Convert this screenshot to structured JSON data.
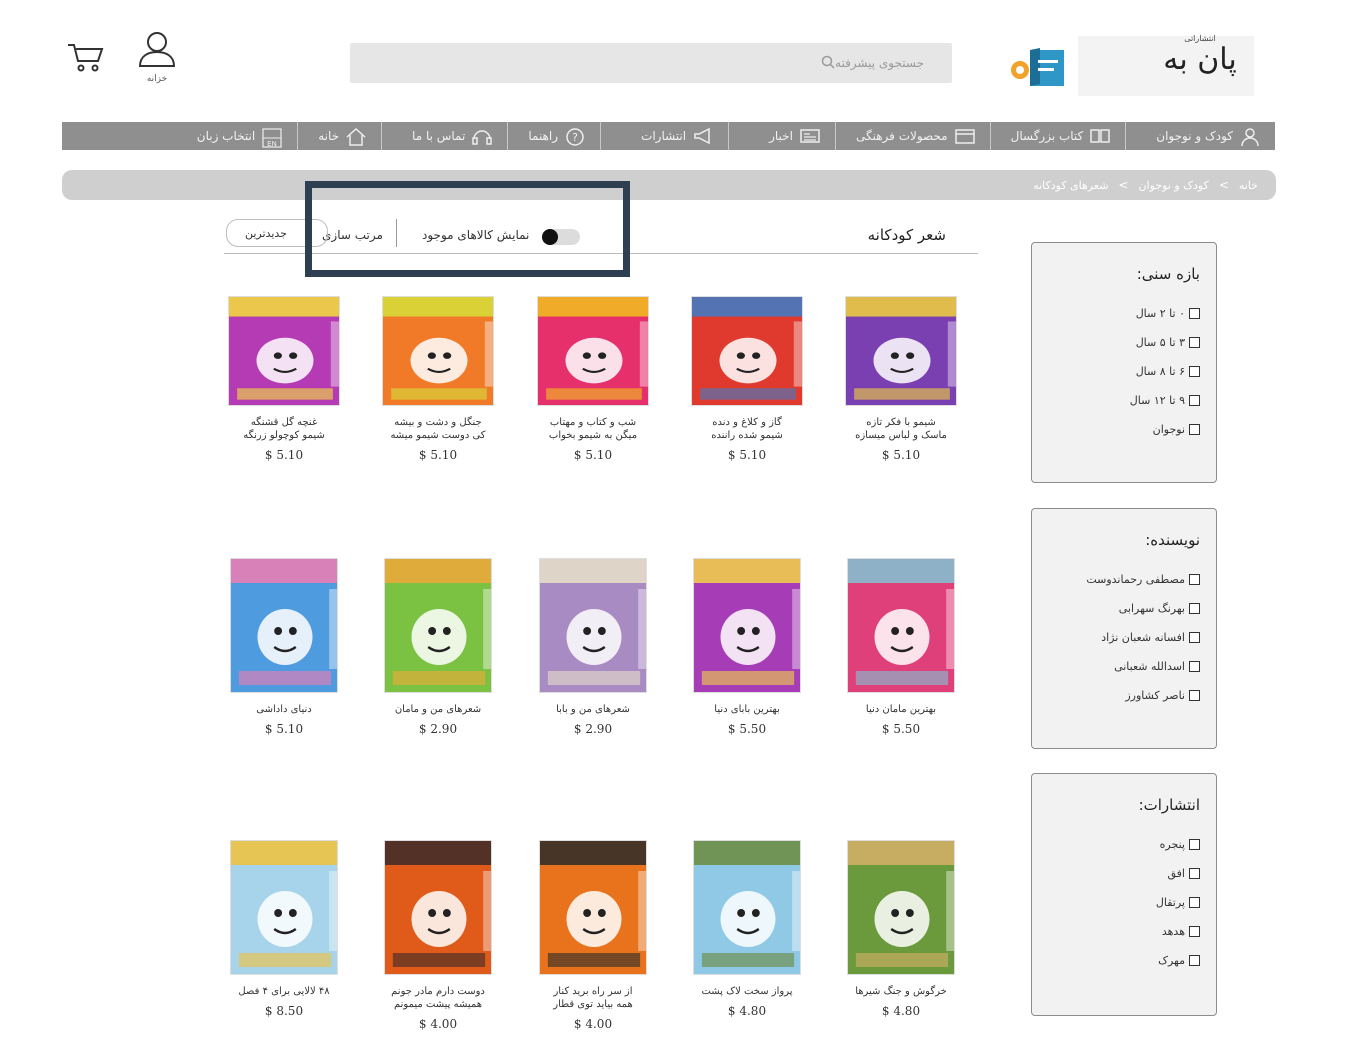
{
  "header": {
    "user_label": "خزانه",
    "search_placeholder": "جستجوی پیشرفته",
    "logo_small": "انتشاراتی",
    "logo_big": "پان به"
  },
  "nav": [
    {
      "label": "کودک و نوجوان",
      "icon": "child-icon"
    },
    {
      "label": "کتاب بزرگسال",
      "icon": "book-icon"
    },
    {
      "label": "محصولات فرهنگی",
      "icon": "package-icon"
    },
    {
      "label": "اخبار",
      "icon": "newspaper-icon"
    },
    {
      "label": "انتشارات",
      "icon": "megaphone-icon"
    },
    {
      "label": "راهنما",
      "icon": "help-icon"
    },
    {
      "label": "تماس با ما",
      "icon": "headset-icon"
    },
    {
      "label": "خانه",
      "icon": "home-icon"
    },
    {
      "label": "انتخاب زبان",
      "icon": "language-icon"
    }
  ],
  "breadcrumb": [
    "خانه",
    "کودک و نوجوان",
    "شعرهای کودکانه"
  ],
  "breadcrumb_sep": ">",
  "toolbar": {
    "title": "شعر کودکانه",
    "show_available_label": "نمایش کالاهای موجود",
    "show_available_on": true,
    "sort_label": "مرتب سازی",
    "sort_value": "جدیدترین"
  },
  "products": [
    {
      "name1": "شیمو با فکر تازه",
      "name2": "ماسک و لباس میسازه",
      "price": "$ 5.10",
      "bg": "#7a3fb0",
      "accent": "#f2d23c"
    },
    {
      "name1": "گاز و کلاغ و دنده",
      "name2": "شیمو شده راننده",
      "price": "$ 5.10",
      "bg": "#e03a2f",
      "accent": "#3a7ec9"
    },
    {
      "name1": "شب و کتاب و مهتاب",
      "name2": "میگن به شیمو بخواب",
      "price": "$ 5.10",
      "bg": "#e5306c",
      "accent": "#f2c21d"
    },
    {
      "name1": "جنگل و دشت و بیشه",
      "name2": "کی دوست شیمو میشه",
      "price": "$ 5.10",
      "bg": "#f07a28",
      "accent": "#d6e03a"
    },
    {
      "name1": "غنچه گل قشنگه",
      "name2": "شیمو کوچولو زرنگه",
      "price": "$ 5.10",
      "bg": "#b53bb5",
      "accent": "#f5e23a"
    },
    {
      "name1": "بهترین مامان دنیا",
      "name2": "",
      "price": "$ 5.50",
      "bg": "#e0407a",
      "accent": "#7fc6d6"
    },
    {
      "name1": "بهترین بابای دنیا",
      "name2": "",
      "price": "$ 5.50",
      "bg": "#a63db7",
      "accent": "#f3d447"
    },
    {
      "name1": "شعرهای من و بابا",
      "name2": "",
      "price": "$ 2.90",
      "bg": "#a98bc4",
      "accent": "#e7e0c8"
    },
    {
      "name1": "شعرهای من و مامان",
      "name2": "",
      "price": "$ 2.90",
      "bg": "#7cc242",
      "accent": "#f1a83a"
    },
    {
      "name1": "دنیای داداشی",
      "name2": "",
      "price": "$ 5.10",
      "bg": "#4f9be0",
      "accent": "#f07cb0"
    },
    {
      "name1": "خرگوش و جنگ شیرها",
      "name2": "",
      "price": "$ 4.80",
      "bg": "#6a9a3b",
      "accent": "#d6b06a"
    },
    {
      "name1": "پرواز سخت لاک پشت",
      "name2": "",
      "price": "$ 4.80",
      "bg": "#8fc9e6",
      "accent": "#6b8a3c"
    },
    {
      "name1": "از سر راه برید کنار",
      "name2": "همه بیاید توی قطار",
      "price": "$ 4.00",
      "bg": "#e8731c",
      "accent": "#2a2a2a"
    },
    {
      "name1": "دوست دارم مادر جونم",
      "name2": "همیشه پیشت میمونم",
      "price": "$ 4.00",
      "bg": "#e05a1a",
      "accent": "#3a2a2a"
    },
    {
      "name1": "۴۸ لالایی برای ۴ فصل",
      "name2": "",
      "price": "$ 8.50",
      "bg": "#a7d4ea",
      "accent": "#f2c23a"
    }
  ],
  "filters": [
    {
      "title": "بازه سنی:",
      "options": [
        "۰ تا ۲ سال",
        "۳ تا ۵ سال",
        "۶ تا ۸ سال",
        "۹ تا ۱۲ سال",
        "نوجوان"
      ]
    },
    {
      "title": "نویسنده:",
      "options": [
        "مصطفی رحماندوست",
        "بهرنگ سهرابی",
        "افسانه شعبان نژاد",
        "اسدالله شعبانی",
        "ناصر کشاورز"
      ]
    },
    {
      "title": "انتشارات:",
      "options": [
        "پنجره",
        "افق",
        "پرتقال",
        "هدهد",
        "مهرک"
      ]
    }
  ]
}
